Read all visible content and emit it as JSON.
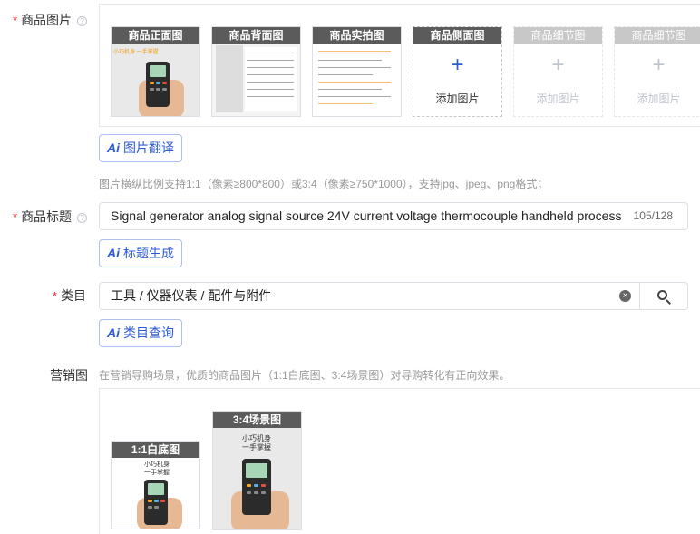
{
  "images": {
    "label": "商品图片",
    "slots": [
      {
        "title": "商品正面图",
        "filled": true
      },
      {
        "title": "商品背面图",
        "filled": true
      },
      {
        "title": "商品实拍图",
        "filled": true
      },
      {
        "title": "商品侧面图",
        "filled": false,
        "add_label": "添加图片"
      },
      {
        "title": "商品细节图",
        "filled": false,
        "add_label": "添加图片"
      },
      {
        "title": "商品细节图",
        "filled": false,
        "add_label": "添加图片"
      }
    ],
    "plus_symbol": "+",
    "translate_button": "图片翻译",
    "hint": "图片横纵比例支持1:1（像素≥800*800）或3:4（像素≥750*1000），支持jpg、jpeg、png格式；"
  },
  "title_field": {
    "label": "商品标题",
    "value": "Signal generator analog signal source 24V current voltage thermocouple handheld process",
    "count": "105/128",
    "generate_button": "标题生成"
  },
  "category": {
    "label": "类目",
    "value": "工具 / 仪器仪表 / 配件与附件",
    "query_button": "类目查询"
  },
  "marketing": {
    "label": "营销图",
    "hint": "在营销导购场景，优质的商品图片（1:1白底图、3:4场景图）对导购转化有正向效果。",
    "slots": [
      {
        "title": "1:1白底图",
        "caption_lines": [
          "小巧机身",
          "一手掌握"
        ]
      },
      {
        "title": "3:4场景图",
        "caption_lines": [
          "小巧机身",
          "一手掌握"
        ]
      }
    ]
  },
  "ai_mark": "Ai",
  "required_mark": "*",
  "help_mark": "?",
  "clear_mark": "×",
  "colors": {
    "accent": "#2d5bd6",
    "required": "#f5222d",
    "slot_title_bg": "#5b5b5b"
  },
  "icons": [
    "help-icon",
    "plus-icon",
    "ai-icon",
    "clear-icon",
    "search-icon"
  ]
}
